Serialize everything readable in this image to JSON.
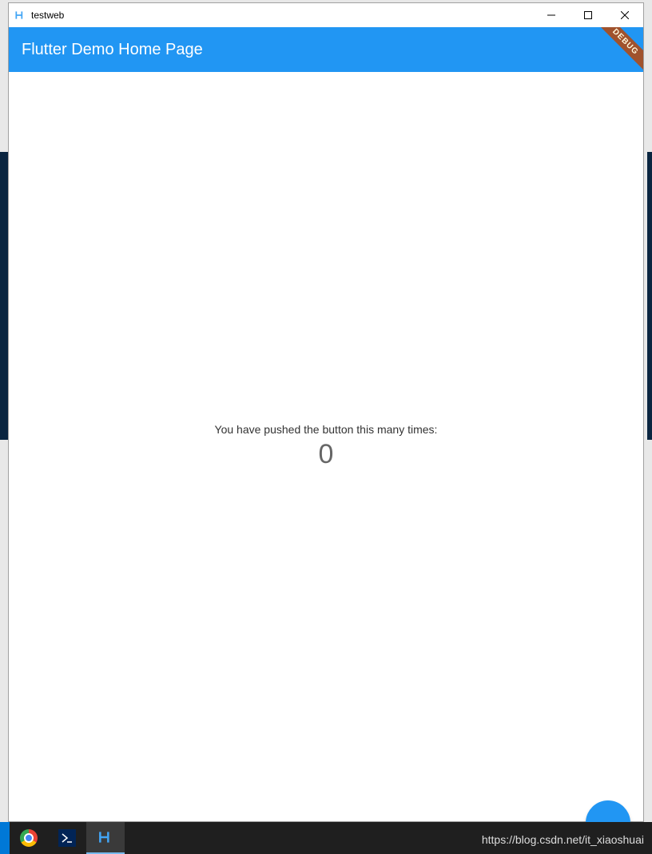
{
  "window": {
    "title": "testweb"
  },
  "appbar": {
    "title": "Flutter Demo Home Page",
    "debug_label": "DEBUG"
  },
  "body": {
    "message": "You have pushed the button this many times:",
    "counter": "0"
  },
  "watermark": "https://blog.csdn.net/it_xiaoshuai",
  "colors": {
    "primary": "#2196f3",
    "debug_banner": "#a0522d"
  }
}
